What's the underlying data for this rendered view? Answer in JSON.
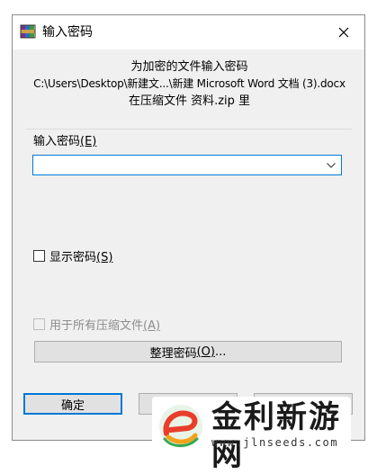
{
  "window": {
    "title": "输入密码",
    "close_glyph": "✕"
  },
  "info": {
    "line1": "为加密的文件输入密码",
    "line2": "C:\\Users\\Desktop\\新建文...\\新建 Microsoft Word 文档 (3).docx",
    "line3": "在压缩文件 资料.zip 里"
  },
  "password": {
    "label": "输入密码",
    "accel": "(E)",
    "value": "",
    "placeholder": ""
  },
  "show_password": {
    "label": "显示密码",
    "accel": "(S)",
    "checked": false
  },
  "use_for_all": {
    "label": "用于所有压缩文件",
    "accel": "(A)",
    "checked": false,
    "enabled": false
  },
  "organize_button": {
    "label": "整理密码",
    "accel": "(O)",
    "suffix": "..."
  },
  "ok_button": {
    "label": "确定"
  },
  "watermark": {
    "brand": "金利新游网",
    "url": "www.jlnseeds.com"
  },
  "colors": {
    "accent": "#0078d7",
    "dialog_bg": "#f0f0f0",
    "button_bg": "#e1e1e1"
  }
}
